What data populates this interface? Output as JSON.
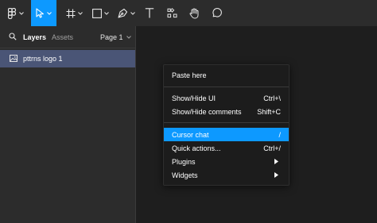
{
  "toolbar": {
    "tools": [
      {
        "icon": "figma-menu-icon"
      },
      {
        "icon": "move-tool-icon",
        "active": true
      },
      {
        "icon": "frame-tool-icon"
      },
      {
        "icon": "shape-tool-icon"
      },
      {
        "icon": "pen-tool-icon"
      },
      {
        "icon": "text-tool-icon"
      },
      {
        "icon": "resources-icon"
      },
      {
        "icon": "hand-tool-icon"
      },
      {
        "icon": "comment-tool-icon"
      }
    ],
    "accent": "#0d99ff"
  },
  "sidebar": {
    "tabs": {
      "layers": "Layers",
      "assets": "Assets"
    },
    "page": "Page 1",
    "layers": [
      {
        "name": "pttrns logo 1",
        "selected": true
      }
    ]
  },
  "context_menu": {
    "items": [
      {
        "label": "Paste here",
        "shortcut": ""
      },
      {
        "label": "Show/Hide UI",
        "shortcut": "Ctrl+\\"
      },
      {
        "label": "Show/Hide comments",
        "shortcut": "Shift+C"
      },
      {
        "label": "Cursor chat",
        "shortcut": "/",
        "highlighted": true
      },
      {
        "label": "Quick actions...",
        "shortcut": "Ctrl+/"
      },
      {
        "label": "Plugins",
        "submenu": true
      },
      {
        "label": "Widgets",
        "submenu": true
      }
    ]
  }
}
